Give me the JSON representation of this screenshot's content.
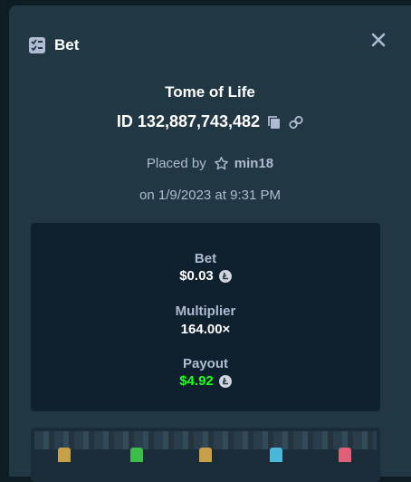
{
  "modal": {
    "title": "Bet",
    "close_icon": "close-icon",
    "title_icon": "bet-list-icon"
  },
  "bet": {
    "game_name": "Tome of Life",
    "id_text": "ID 132,887,743,482",
    "placed_by_label": "Placed by",
    "username": "min18",
    "date_text": "on 1/9/2023 at 9:31 PM"
  },
  "stats": {
    "bet_label": "Bet",
    "bet_value": "$0.03",
    "multiplier_label": "Multiplier",
    "multiplier_value": "164.00×",
    "payout_label": "Payout",
    "payout_value": "$4.92",
    "currency_icon": "litecoin-icon"
  },
  "colors": {
    "background": "#0e1c24",
    "panel": "#213743",
    "stats_panel": "#0f212e",
    "muted_text": "#b1bad3",
    "payout_green": "#1fff20"
  }
}
